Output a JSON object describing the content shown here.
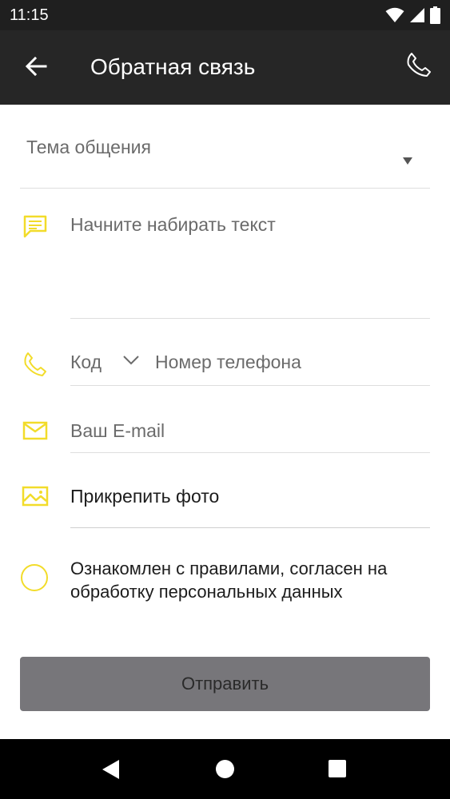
{
  "status_bar": {
    "time": "11:15"
  },
  "app_bar": {
    "title": "Обратная связь",
    "back_icon": "arrow-left-icon",
    "call_icon": "phone-icon"
  },
  "form": {
    "topic": {
      "placeholder": "Тема общения",
      "icon": "dropdown-arrow-icon"
    },
    "message": {
      "placeholder": "Начните набирать текст",
      "icon": "chat-message-icon"
    },
    "phone": {
      "code_placeholder": "Код",
      "number_placeholder": "Номер телефона",
      "icon": "phone-icon"
    },
    "email": {
      "placeholder": "Ваш E-mail",
      "icon": "envelope-icon"
    },
    "attach": {
      "label": "Прикрепить фото",
      "icon": "image-icon"
    },
    "agreement": {
      "text": "Ознакомлен с правилами, согласен на обработку персональных данных",
      "checked": false
    },
    "submit_label": "Отправить"
  },
  "colors": {
    "accent": "#f2dc2a",
    "app_bar": "#262626",
    "status_bar": "#1f1f1f",
    "button_disabled": "#77767a"
  }
}
